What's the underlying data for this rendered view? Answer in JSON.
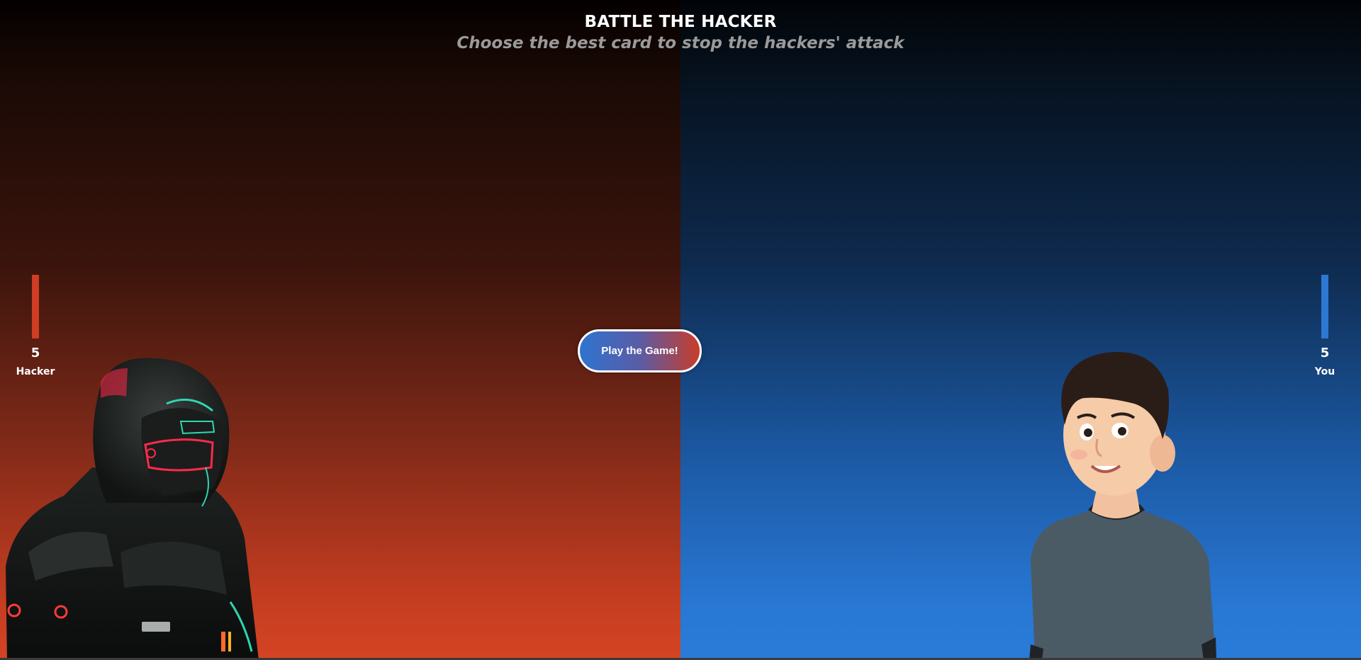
{
  "header": {
    "title": "BATTLE THE HACKER",
    "subtitle": "Choose the best card to stop the hackers' attack"
  },
  "scores": {
    "hacker": {
      "value": "5",
      "label": "Hacker",
      "color": "#d03c24"
    },
    "player": {
      "value": "5",
      "label": "You",
      "color": "#2d78d2"
    }
  },
  "play_button": {
    "label": "Play the Game!"
  },
  "characters": {
    "hacker": {
      "icon": "hooded-hacker-avatar"
    },
    "player": {
      "icon": "boy-avatar"
    }
  },
  "colors": {
    "hacker_side": "#c23c20",
    "player_side": "#2877d4",
    "accent_neon_red": "#ff2a4a",
    "accent_neon_teal": "#2fd6b0"
  }
}
